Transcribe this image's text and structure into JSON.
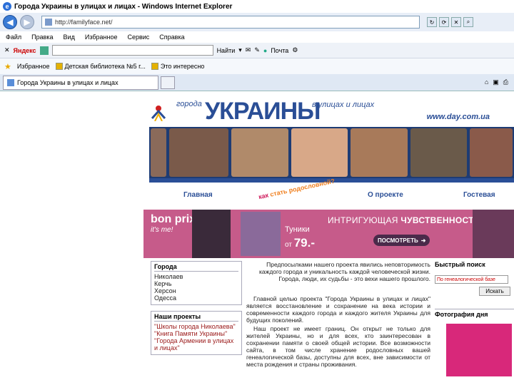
{
  "window": {
    "title": "Города Украины в улицах и лицах - Windows Internet Explorer"
  },
  "address_bar": {
    "url": "http://familyface.net/"
  },
  "menu": {
    "items": [
      "Файл",
      "Правка",
      "Вид",
      "Избранное",
      "Сервис",
      "Справка"
    ]
  },
  "yandex_bar": {
    "brand": "Яндекс",
    "find_label": "Найти",
    "mail_label": "Почта"
  },
  "favorites": {
    "label": "Избранное",
    "items": [
      "Детская библиотека №5 г...",
      "Это интересно"
    ]
  },
  "tabs": [
    {
      "label": "Города Украины в улицах и лицах"
    }
  ],
  "site": {
    "header": {
      "gorod": "города",
      "ukraine": "УКРАИНЫ",
      "streets": "в улицах и лицах",
      "url": "www.day.com.ua"
    },
    "nav": {
      "home": "Главная",
      "kak": "как",
      "kak2": "стать родословной?",
      "about": "О проекте",
      "guest": "Гостевая"
    },
    "banner": {
      "brand": "bon prix",
      "brand_tag": "it's me!",
      "headline_a": "ИНТРИГУЮЩАЯ",
      "headline_b": "ЧУВСТВЕННОСТЬ",
      "item": "Туники",
      "price_from": "от",
      "price": "79.-",
      "cta": "ПОСМОТРЕТЬ"
    },
    "left": {
      "cities_title": "Города",
      "cities": [
        "Николаев",
        "Керчь",
        "Херсон",
        "Одесса"
      ],
      "projects_title": "Наши проекты",
      "projects": [
        "\"Школы города Николаева\"",
        "\"Книга Памяти Украины\"",
        "\"Города Армении в улицах и лицах\""
      ]
    },
    "middle": {
      "intro": "Предпосылками нашего проекта явились неповторимость каждого города и уникальность каждой человеческой жизни. Города, люди, их судьбы - это вехи нашего прошлого.",
      "p1": "Главной целью проекта \"Города Украины в улицах и лицах\" является восстановление и сохранение на века истории и современности каждого города и каждого жителя Украины для будущих поколений.",
      "p2": "Наш проект не имеет границ. Он открыт не только для жителей Украины, но и для всех, кто заинтересован в сохранении памяти о своей общей истории. Все возможности сайта, в том числе хранение родословных вашей генеалогической базы, доступны для всех, вне зависимости от места рождения и страны проживания."
    },
    "right": {
      "search_title": "Быстрый поиск",
      "search_select": "По генеалогической базе",
      "search_button": "Искать",
      "photo_title": "Фотография дня"
    }
  },
  "colors": {
    "brand_blue": "#2a4e96",
    "banner_pink": "#c65b8a",
    "ie_chrome": "#e8eef7"
  }
}
